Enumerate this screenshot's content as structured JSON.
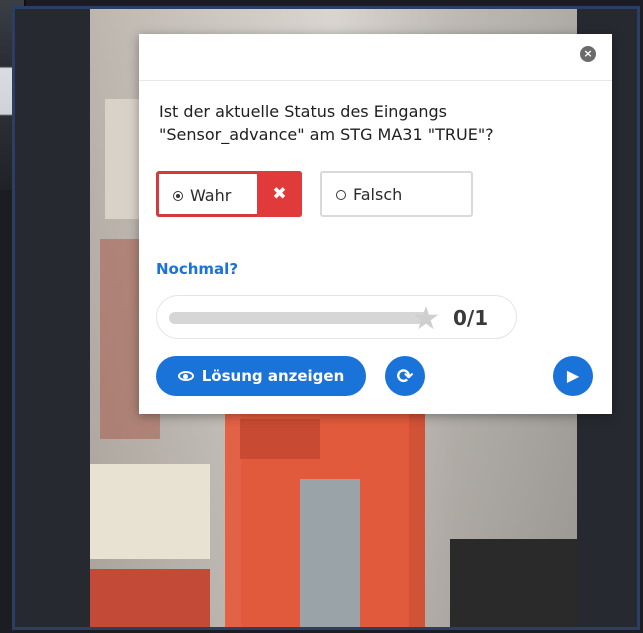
{
  "modal": {
    "close_icon": "close-icon",
    "question_line1": "Ist der aktuelle Status des Eingangs",
    "question_line2": "\"Sensor_advance\" am STG MA31 \"TRUE\"?",
    "answers": [
      {
        "label": "Wahr",
        "selected": true,
        "status": "wrong"
      },
      {
        "label": "Falsch",
        "selected": false
      }
    ],
    "retry_link": "Nochmal?",
    "score": {
      "current": 0,
      "total": 1,
      "text": "0/1",
      "fraction": 0.0
    },
    "solution_button": "Lösung anzeigen",
    "retry_icon": "refresh-icon",
    "next_icon": "play-icon"
  },
  "colors": {
    "accent_blue": "#1a73d9",
    "wrong_red": "#e03a3a",
    "frame_border": "#2b3f63"
  }
}
